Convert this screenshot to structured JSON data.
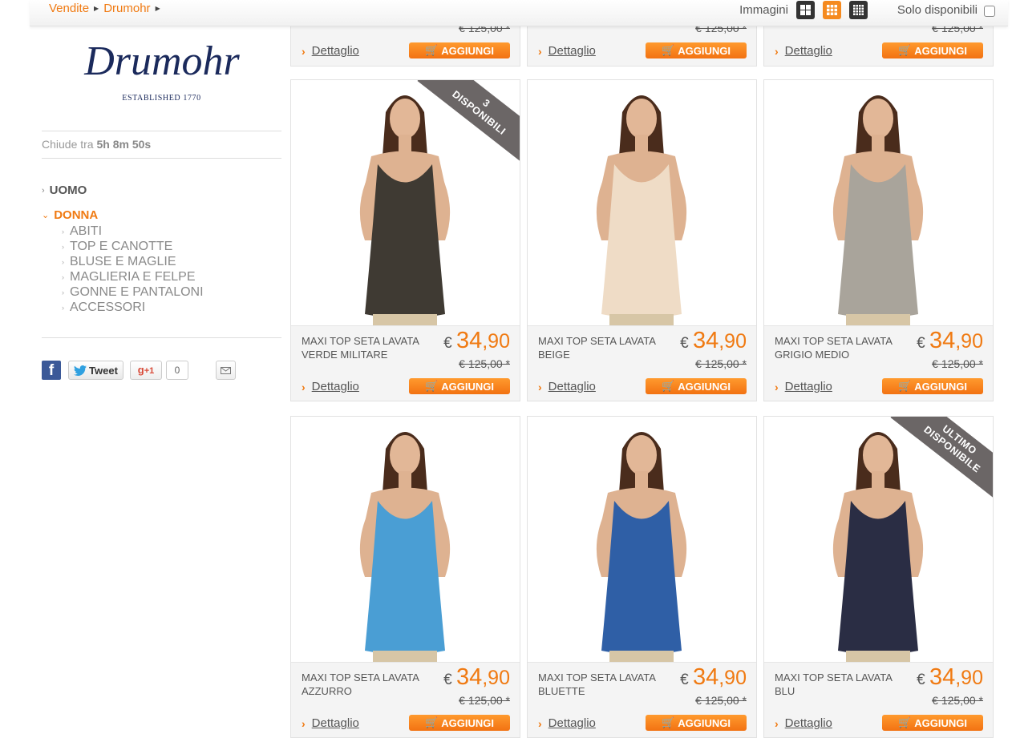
{
  "breadcrumb": [
    "Vendite",
    "Drumohr"
  ],
  "view": {
    "label": "Immagini",
    "solo_label": "Solo disponibili"
  },
  "brand": {
    "name": "Drumohr",
    "established": "ESTABLISHED 1770"
  },
  "timer": {
    "prefix": "Chiude tra",
    "h": "5h",
    "m": "8m",
    "s": "50s"
  },
  "categories": [
    {
      "label": "UOMO",
      "open": false
    },
    {
      "label": "DONNA",
      "open": true
    }
  ],
  "subcategories": [
    "ABITI",
    "TOP E CANOTTE",
    "BLUSE E MAGLIE",
    "MAGLIERIA E FELPE",
    "GONNE E PANTALONI",
    "ACCESSORI"
  ],
  "share": {
    "tweet": "Tweet",
    "gplus": "+1",
    "gplus_count": "0"
  },
  "labels": {
    "detail": "Dettaglio",
    "add": "AGGIUNGI",
    "currency": "€"
  },
  "top_row": [
    {
      "old_price": "€ 125,00 *"
    },
    {
      "old_price": "€ 125,00 *"
    },
    {
      "old_price": "€ 125,00 *"
    }
  ],
  "products": [
    {
      "name": "MAXI TOP SETA LAVATA VERDE MILITARE",
      "price_int": "34",
      "price_dec": ",90",
      "old_price": "€ 125,00 *",
      "ribbon": "3\nDISPONIBILI",
      "color": "#3f3a33"
    },
    {
      "name": "MAXI TOP SETA LAVATA BEIGE",
      "price_int": "34",
      "price_dec": ",90",
      "old_price": "€ 125,00 *",
      "ribbon": "",
      "color": "#efdcc6"
    },
    {
      "name": "MAXI TOP SETA LAVATA GRIGIO MEDIO",
      "price_int": "34",
      "price_dec": ",90",
      "old_price": "€ 125,00 *",
      "ribbon": "",
      "color": "#a9a49b"
    },
    {
      "name": "MAXI TOP SETA LAVATA AZZURRO",
      "price_int": "34",
      "price_dec": ",90",
      "old_price": "€ 125,00 *",
      "ribbon": "",
      "color": "#4a9ed4"
    },
    {
      "name": "MAXI TOP SETA LAVATA BLUETTE",
      "price_int": "34",
      "price_dec": ",90",
      "old_price": "€ 125,00 *",
      "ribbon": "",
      "color": "#2f5fa6"
    },
    {
      "name": "MAXI TOP SETA LAVATA BLU",
      "price_int": "34",
      "price_dec": ",90",
      "old_price": "€ 125,00 *",
      "ribbon": "ULTIMO\nDISPONIBILE",
      "color": "#2a2d44"
    }
  ],
  "colors": {
    "accent": "#f07a12",
    "button": "#f58a1f"
  }
}
